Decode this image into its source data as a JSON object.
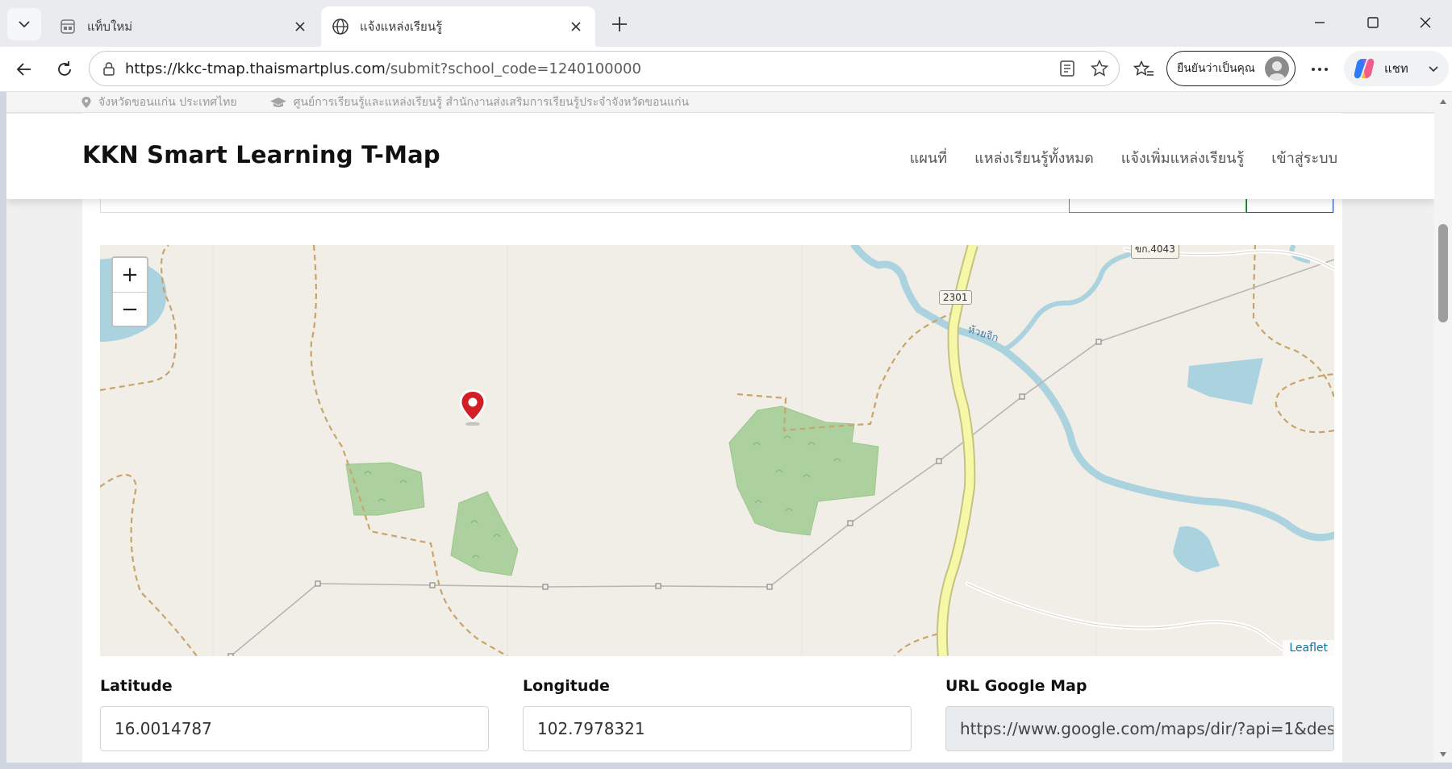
{
  "browser": {
    "tabs": [
      {
        "title": "แท็บใหม่",
        "icon": "new-tab-page-icon",
        "active": false
      },
      {
        "title": "แจ้งแหล่งเรียนรู้",
        "icon": "globe-icon",
        "active": true
      }
    ],
    "url_host": "https://kkc-tmap.thaismartplus.com",
    "url_path": "/submit?school_code=1240100000",
    "profile_label": "ยืนยันว่าเป็นคุณ",
    "copilot_label": "แชท"
  },
  "page": {
    "topbar": {
      "location": "จังหวัดขอนแก่น ประเทศไทย",
      "organization": "ศูนย์การเรียนรู้และแหล่งเรียนรู้ สำนักงานส่งเสริมการเรียนรู้ประจำจังหวัดขอนแก่น"
    },
    "brand": "KKN Smart Learning T-Map",
    "nav": [
      "แผนที่",
      "แหล่งเรียนรู้ทั้งหมด",
      "แจ้งเพิ่มแหล่งเรียนรู้",
      "เข้าสู่ระบบ"
    ],
    "map": {
      "zoom_in": "+",
      "zoom_out": "−",
      "attribution": "Leaflet",
      "road_labels": [
        "2301",
        "ขก.4043"
      ],
      "river_label": "ห้วยจิก"
    },
    "form": {
      "latitude_label": "Latitude",
      "latitude_value": "16.0014787",
      "longitude_label": "Longitude",
      "longitude_value": "102.7978321",
      "gmap_label": "URL Google Map",
      "gmap_value": "https://www.google.com/maps/dir/?api=1&des"
    }
  },
  "colors": {
    "accent_green": "#3aa655",
    "accent_blue": "#2b4fb5",
    "marker_red": "#d21f26",
    "leaflet_link": "#0078a8"
  }
}
